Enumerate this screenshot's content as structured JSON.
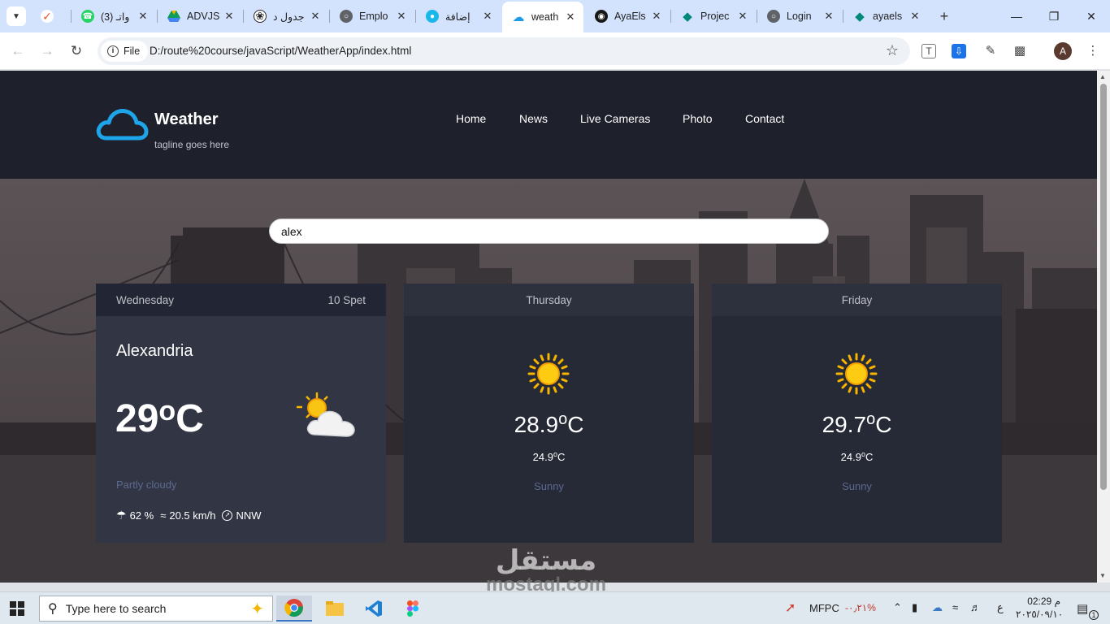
{
  "browser": {
    "tabs": [
      {
        "title": "",
        "favicon": "check-icon",
        "color": "#e4572e"
      },
      {
        "title": "(3) واتـ",
        "favicon": "whatsapp-icon",
        "color": "#25d366"
      },
      {
        "title": "ADVJS",
        "favicon": "drive-icon",
        "color": "#f4b400"
      },
      {
        "title": "جدول د",
        "favicon": "openai-icon",
        "color": "#222222"
      },
      {
        "title": "Emplo",
        "favicon": "globe-icon",
        "color": "#5f6368"
      },
      {
        "title": "إضافة",
        "favicon": "circle-icon",
        "color": "#1ab7ea"
      },
      {
        "title": "weath",
        "favicon": "cloud-icon",
        "color": "#1e9be6"
      },
      {
        "title": "AyaEls",
        "favicon": "github-icon",
        "color": "#181717"
      },
      {
        "title": "Projec",
        "favicon": "diamond-icon",
        "color": "#00897b"
      },
      {
        "title": "Login",
        "favicon": "globe-icon",
        "color": "#5f6368"
      },
      {
        "title": "ayaels",
        "favicon": "diamond-icon",
        "color": "#00897b"
      }
    ],
    "active_tab": 6,
    "site_chip": "File",
    "url": "D:/route%20course/javaScript/WeatherApp/index.html"
  },
  "site": {
    "logo_title": "Weather",
    "tagline": "tagline goes here",
    "menu": [
      "Home",
      "News",
      "Live Cameras",
      "Photo",
      "Contact"
    ]
  },
  "search": {
    "value": "alex"
  },
  "today": {
    "day": "Wednesday",
    "date": "10 Spet",
    "city": "Alexandria",
    "temp": "29",
    "unit": "oC",
    "condition": "Partly cloudy",
    "humidity": "62 %",
    "wind": "20.5 km/h",
    "direction": "NNW"
  },
  "forecast": [
    {
      "day": "Thursday",
      "max": "28.9",
      "min": "24.9",
      "unit": "oC",
      "condition": "Sunny"
    },
    {
      "day": "Friday",
      "max": "29.7",
      "min": "24.9",
      "unit": "oC",
      "condition": "Sunny"
    }
  ],
  "taskbar": {
    "search_placeholder": "Type here to search",
    "tray_label": "MFPC",
    "tray_change": "-٠٫٢١%",
    "lang": "ع",
    "time": "02:29 م",
    "date": "٢٠٢٥/٠٩/١٠",
    "notif_count": "1"
  },
  "watermark": {
    "ar": "مستقل",
    "en": "mostaql.com"
  }
}
